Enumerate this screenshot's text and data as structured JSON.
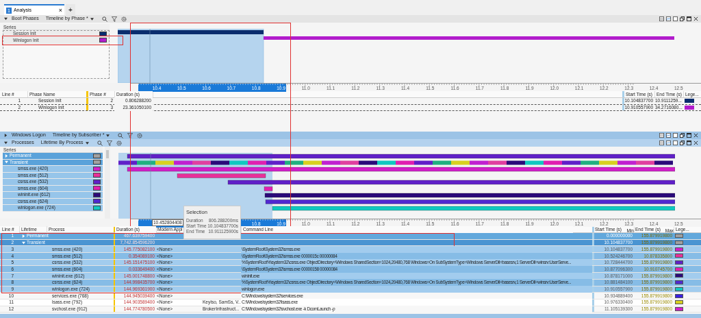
{
  "tabs": [
    {
      "number": "1",
      "label": "Analysis",
      "selected": true,
      "close": "×"
    }
  ],
  "new_tab": "+",
  "boot_phases": {
    "title": "Boot Phases",
    "view": "Timeline by Phase *",
    "expanded": true,
    "series_header": "Series",
    "series": [
      {
        "label": "Session Init",
        "color": "#0a2d6e"
      },
      {
        "label": "Winlogon Init",
        "color": "#b21ccc"
      }
    ],
    "axis": [
      "10.4",
      "10.5",
      "10.6",
      "10.7",
      "10.8",
      "10.9",
      "11.0",
      "11.1",
      "11.2",
      "11.3",
      "11.4",
      "11.5",
      "11.6",
      "11.7",
      "11.8",
      "11.9",
      "12.0",
      "12.1",
      "12.2",
      "12.3",
      "12.4",
      "12.5"
    ],
    "columns": [
      "Line #",
      "Phase Name",
      "Phase #",
      "Duration (s)",
      "Start Time (s)",
      "End Time (s)",
      "Lege..."
    ],
    "rows": [
      {
        "line": "1",
        "name": "Session Init",
        "phase": "2",
        "duration": "0.806288200",
        "start": "10.104837700",
        "end": "10.9111259...",
        "color": "#0a2d6e"
      },
      {
        "line": "2",
        "name": "Winlogon Init",
        "phase": "3",
        "duration": "23.361050100",
        "start": "10.910557900",
        "end": "34.2716080...",
        "color": "#b21ccc"
      }
    ]
  },
  "windows_logon": {
    "title": "Windows Logon",
    "view": "Timeline by Subscriber *",
    "expanded": false
  },
  "processes": {
    "title": "Processes",
    "view": "Lifetime By Process",
    "expanded": true,
    "series_header": "Series",
    "series": [
      {
        "label": "Permanent",
        "color": "#a0a0a0",
        "expanded": false
      },
      {
        "label": "Transient",
        "color": "#a0a0a0",
        "expanded": true,
        "children": [
          {
            "label": "smss.exe (420)",
            "color": "#d020c8"
          },
          {
            "label": "smss.exe (512)",
            "color": "#e8309a"
          },
          {
            "label": "csrss.exe (532)",
            "color": "#6020c8"
          },
          {
            "label": "smss.exe (604)",
            "color": "#e020b0"
          },
          {
            "label": "wininit.exe (612)",
            "color": "#2a0a7a"
          },
          {
            "label": "csrss.exe (624)",
            "color": "#5028d0"
          },
          {
            "label": "winlogon.exe (724)",
            "color": "#10c8c0"
          }
        ]
      }
    ],
    "cursor_label": "10.452804408",
    "axis": [
      "10.8",
      "10.9",
      "11.0",
      "11.1",
      "11.2",
      "11.3",
      "11.4",
      "11.5",
      "11.6",
      "11.7",
      "11.8",
      "11.9",
      "12.0",
      "12.1",
      "12.2",
      "12.3",
      "12.4",
      "12.5"
    ],
    "columns": [
      {
        "label": "Line #"
      },
      {
        "label": "Lifetime"
      },
      {
        "label": "Process"
      },
      {
        "label": "Duration (s)"
      },
      {
        "label": "Modern Appl"
      },
      {
        "label": "Command Line"
      },
      {
        "label": "Start Time (s)",
        "sub": "Min"
      },
      {
        "label": "End Time (s)",
        "sub": "Max"
      },
      {
        "label": "Lege..."
      }
    ],
    "rows": [
      {
        "line": "1",
        "kind": "group",
        "expanded": false,
        "name": "Permanent",
        "duration": "467.639759400",
        "start": "0.000000000",
        "end": "155.879919800",
        "color": "#a0a0a0",
        "selected": true
      },
      {
        "line": "2",
        "kind": "group",
        "expanded": true,
        "name": "Transient",
        "duration": "7,742.854596200",
        "start": "10.104837700",
        "end": "155.879919800",
        "color": "#a0a0a0",
        "selected": true
      },
      {
        "line": "3",
        "kind": "process",
        "name": "smss.exe (420)",
        "duration": "145.775082100",
        "app": "<None>",
        "command": "\\SystemRoot\\System32\\smss.exe",
        "start": "10.104837700",
        "end": "155.879919800",
        "color": "#d020c8",
        "selected": true
      },
      {
        "line": "4",
        "kind": "process",
        "name": "smss.exe (512)",
        "duration": "0.354089100",
        "app": "<None>",
        "command": "\\SystemRoot\\System32\\smss.exe 0000015c 00000084",
        "start": "10.524246700",
        "end": "10.878335800",
        "color": "#e8309a",
        "selected": true
      },
      {
        "line": "5",
        "kind": "process",
        "name": "csrss.exe (532)",
        "duration": "145.151475100",
        "app": "<None>",
        "command": "%SystemRoot%\\system32\\csrss.exe ObjectDirectory=\\Windows SharedSection=1024,20480,768 Windows=On SubSystemType=Windows ServerDll=basesrv,1 ServerDll=winsrv:UserServe...",
        "start": "10.728444700",
        "end": "155.879919800",
        "color": "#6020c8",
        "selected": true
      },
      {
        "line": "6",
        "kind": "process",
        "name": "smss.exe (604)",
        "duration": "0.033649400",
        "app": "<None>",
        "command": "\\SystemRoot\\System32\\smss.exe 00000158 00000084",
        "start": "10.877096300",
        "end": "10.910745700",
        "color": "#e020b0",
        "selected": true
      },
      {
        "line": "7",
        "kind": "process",
        "name": "wininit.exe (612)",
        "duration": "145.001748800",
        "app": "<None>",
        "command": "wininit.exe",
        "start": "10.878171000",
        "end": "155.879919800",
        "color": "#2a0a7a",
        "selected": true
      },
      {
        "line": "8",
        "kind": "process",
        "name": "csrss.exe (624)",
        "duration": "144.998435700",
        "app": "<None>",
        "command": "%SystemRoot%\\system32\\csrss.exe ObjectDirectory=\\Windows SharedSection=1024,20480,768 Windows=On SubSystemType=Windows ServerDll=basesrv,1 ServerDll=winsrv:UserServe...",
        "start": "10.881484100",
        "end": "155.879919800",
        "color": "#5028d0",
        "selected": true
      },
      {
        "line": "9",
        "kind": "process",
        "name": "winlogon.exe (724)",
        "duration": "144.969361900",
        "app": "<None>",
        "command": "winlogon.exe",
        "start": "10.910557900",
        "end": "155.879919800",
        "color": "#10c8c0",
        "selected": true
      },
      {
        "line": "10",
        "kind": "process",
        "name": "services.exe (768)",
        "duration": "144.945039400",
        "app": "<None>",
        "command": "C:\\Windows\\system32\\services.exe",
        "start": "10.934889400",
        "end": "155.879919800",
        "color": "#3a20e0",
        "selected": false
      },
      {
        "line": "11",
        "kind": "process",
        "name": "lsass.exe (792)",
        "duration": "144.903589400",
        "app": "<None>",
        "services": "KeyIso, SamSs, V...",
        "command": "C:\\Windows\\system32\\lsass.exe",
        "start": "10.976330400",
        "end": "155.879919800",
        "color": "#d8d020",
        "selected": false
      },
      {
        "line": "12",
        "kind": "process",
        "name": "svchost.exe (912)",
        "duration": "144.774780500",
        "app": "<None>",
        "services": "BrokerInfrastruct...",
        "command": "C:\\Windows\\system32\\svchost.exe -k DcomLaunch -p",
        "start": "11.105139300",
        "end": "155.879919800",
        "color": "#d020c8",
        "selected": false
      }
    ]
  },
  "tooltip": {
    "title": "Selection",
    "rows": [
      {
        "label": "Duration",
        "value": "806.288200ms"
      },
      {
        "label": "Start Time",
        "value": "10.104837700s"
      },
      {
        "label": "End Time",
        "value": "10.911125900s"
      }
    ]
  }
}
